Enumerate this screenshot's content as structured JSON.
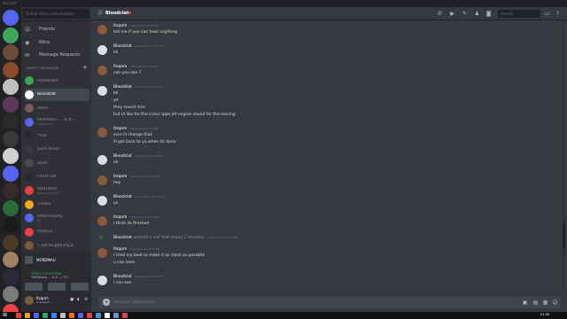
{
  "window": {
    "title": "Discord"
  },
  "servers": [
    {
      "name": "home",
      "color": "#5865f2"
    },
    {
      "name": "server-1",
      "color": "#3ba55c"
    },
    {
      "name": "server-2",
      "color": "#6b4a3a"
    },
    {
      "name": "server-3",
      "color": "#8b4a2b"
    },
    {
      "name": "server-4",
      "color": "#c0c0c0"
    },
    {
      "name": "server-5",
      "color": "#5a3a5a"
    },
    {
      "name": "server-6",
      "color": "#2a2a2a"
    },
    {
      "name": "server-7",
      "color": "#3a3a3a"
    },
    {
      "name": "server-8",
      "color": "#d0d0d0"
    },
    {
      "name": "server-9",
      "color": "#5865f2"
    },
    {
      "name": "server-10",
      "color": "#3a2a2a"
    },
    {
      "name": "server-11",
      "color": "#2a6b3a"
    },
    {
      "name": "server-12",
      "color": "#1a1a1a"
    },
    {
      "name": "server-13",
      "color": "#4a3a2a"
    },
    {
      "name": "server-14",
      "color": "#a08060"
    },
    {
      "name": "server-15",
      "color": "#2a2a3a"
    },
    {
      "name": "server-16",
      "color": "#7a7a7a"
    },
    {
      "name": "server-17",
      "color": "#ed4245"
    }
  ],
  "dm_sidebar": {
    "search_placeholder": "Find or start a conversation",
    "nav": [
      {
        "label": "Friends",
        "icon": "friends-icon"
      },
      {
        "label": "Nitro",
        "icon": "nitro-icon"
      },
      {
        "label": "Message Requests",
        "icon": "envelope-icon"
      }
    ],
    "header": "DIRECT MESSAGES",
    "items": [
      {
        "name": "HiddenBot",
        "color": "#3ba55c"
      },
      {
        "name": "Bloodclat",
        "color": "#ffffff",
        "selected": true
      },
      {
        "name": "melle",
        "color": "#7a5c5c"
      },
      {
        "name": "PePeRono, ... & K...",
        "sub": "8 Members",
        "color": "#5865f2"
      },
      {
        "name": "*Soo",
        "color": "#2a2a2a"
      },
      {
        "name": "Dark Booty",
        "color": "#3a3a3a"
      },
      {
        "name": "boise",
        "color": "#4a4a4a"
      },
      {
        "name": "FR4NT3M",
        "color": "#2a2a2a"
      },
      {
        "name": "RoD18Pro",
        "sub": "Streaming Tiptil",
        "color": "#ed4245"
      },
      {
        "name": "Cookie",
        "color": "#faa61a"
      },
      {
        "name": "retard Booky",
        "sub": "PIT",
        "color": "#5865f2"
      },
      {
        "name": "RoDevs",
        "color": "#ed4245"
      },
      {
        "name": "! »§©¥£ightning §",
        "color": "#7a5a3a"
      },
      {
        "name": "Bolko",
        "color": "#4a4a4a"
      }
    ]
  },
  "voice": {
    "server_label": "MORDMAU",
    "status": "Voice Connected",
    "channel": "PePeRono ... & K... / TS...",
    "user": {
      "name": "Itsqom",
      "tag": "one batch..."
    }
  },
  "chat": {
    "channel_name": "Bloodclat",
    "search_placeholder": "Search",
    "composer_placeholder": "Message @Bloodclat",
    "messages": [
      {
        "author": "Itsqom",
        "ts": "Yesterday at 9:04 PM",
        "lines": [
          "tell me if you can hear anything"
        ],
        "color": "#8b5a3a"
      },
      {
        "author": "Bloodclat",
        "ts": "Yesterday at 9:04 PM",
        "lines": [
          "kk"
        ],
        "color": "#dcddde"
      },
      {
        "author": "Itsqom",
        "ts": "Yesterday at 9:05 PM",
        "lines": [
          "can you see ?"
        ],
        "color": "#8b5a3a"
      },
      {
        "author": "Bloodclat",
        "ts": "Yesterday at 9:05 PM",
        "lines": [
          "kk",
          "ye",
          "they sound nice",
          "but id like for the iconic ippo jet engine sound for the leaving"
        ],
        "color": "#dcddde"
      },
      {
        "author": "Itsqom",
        "ts": "Yesterday at 9:05 PM",
        "lines": [
          "sure ill change that",
          "ill get back to ya when its done"
        ],
        "color": "#8b5a3a"
      },
      {
        "author": "Bloodclat",
        "ts": "Yesterday at 9:06 PM",
        "lines": [
          "ok"
        ],
        "color": "#dcddde"
      },
      {
        "author": "Itsqom",
        "ts": "Yesterday at 10:13 PM",
        "lines": [
          "hey"
        ],
        "color": "#8b5a3a"
      },
      {
        "author": "Bloodclat",
        "ts": "Yesterday at 10:13 PM",
        "lines": [
          "yo"
        ],
        "color": "#dcddde"
      },
      {
        "author": "Itsqom",
        "ts": "Yesterday at 10:13 PM",
        "lines": [
          "i think its finished"
        ],
        "color": "#8b5a3a"
      },
      {
        "system": true,
        "author": "Bloodclat",
        "text": "started a call that lasted 2 minutes.",
        "ts": "Yesterday at 10:14 PM"
      },
      {
        "author": "Itsqom",
        "ts": "Yesterday at 10:14 PM",
        "lines": [
          "i tried my best to make it as close as possible",
          "u can seee"
        ],
        "color": "#8b5a3a"
      },
      {
        "author": "Bloodclat",
        "ts": "Yesterday at 10:14 PM",
        "lines": [
          "i can see"
        ],
        "color": "#dcddde"
      },
      {
        "author": "Itsqom",
        "ts": "Yesterday at 10:14 PM",
        "lines": [],
        "color": "#8b5a3a"
      }
    ]
  },
  "taskbar": {
    "clock": "01:00",
    "apps": [
      "#ed4245",
      "#f0a020",
      "#5865f2",
      "#3ba55c",
      "#2d8cff",
      "#c0c0c0",
      "#ff6a00",
      "#5865f2",
      "#ed4245",
      "#3a96dd",
      "#ffffff",
      "#7289da",
      "#e04060"
    ]
  }
}
